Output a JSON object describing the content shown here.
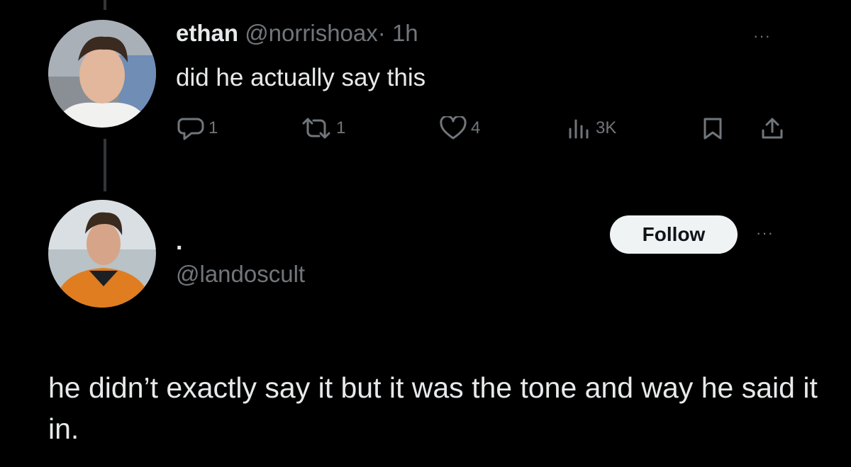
{
  "tweet": {
    "author_name": "ethan",
    "author_handle": "@norrishoax",
    "separator": "·",
    "time": "1h",
    "text": "did he actually say this",
    "more_label": "···",
    "actions": {
      "reply_count": "1",
      "retweet_count": "1",
      "like_count": "4",
      "views_count": "3K"
    },
    "icons": [
      "reply-icon",
      "retweet-icon",
      "like-icon",
      "views-icon",
      "bookmark-icon",
      "share-icon"
    ]
  },
  "profile_card": {
    "display_name": ".",
    "handle": "@landoscult",
    "follow_label": "Follow",
    "more_label": "···"
  },
  "reply": {
    "text": "he didn’t exactly say it but it was the tone and way he said it in."
  },
  "colors": {
    "background": "#000000",
    "primary_text": "#e7e9ea",
    "secondary_text": "#71767b",
    "follow_button_bg": "#eff3f4"
  }
}
